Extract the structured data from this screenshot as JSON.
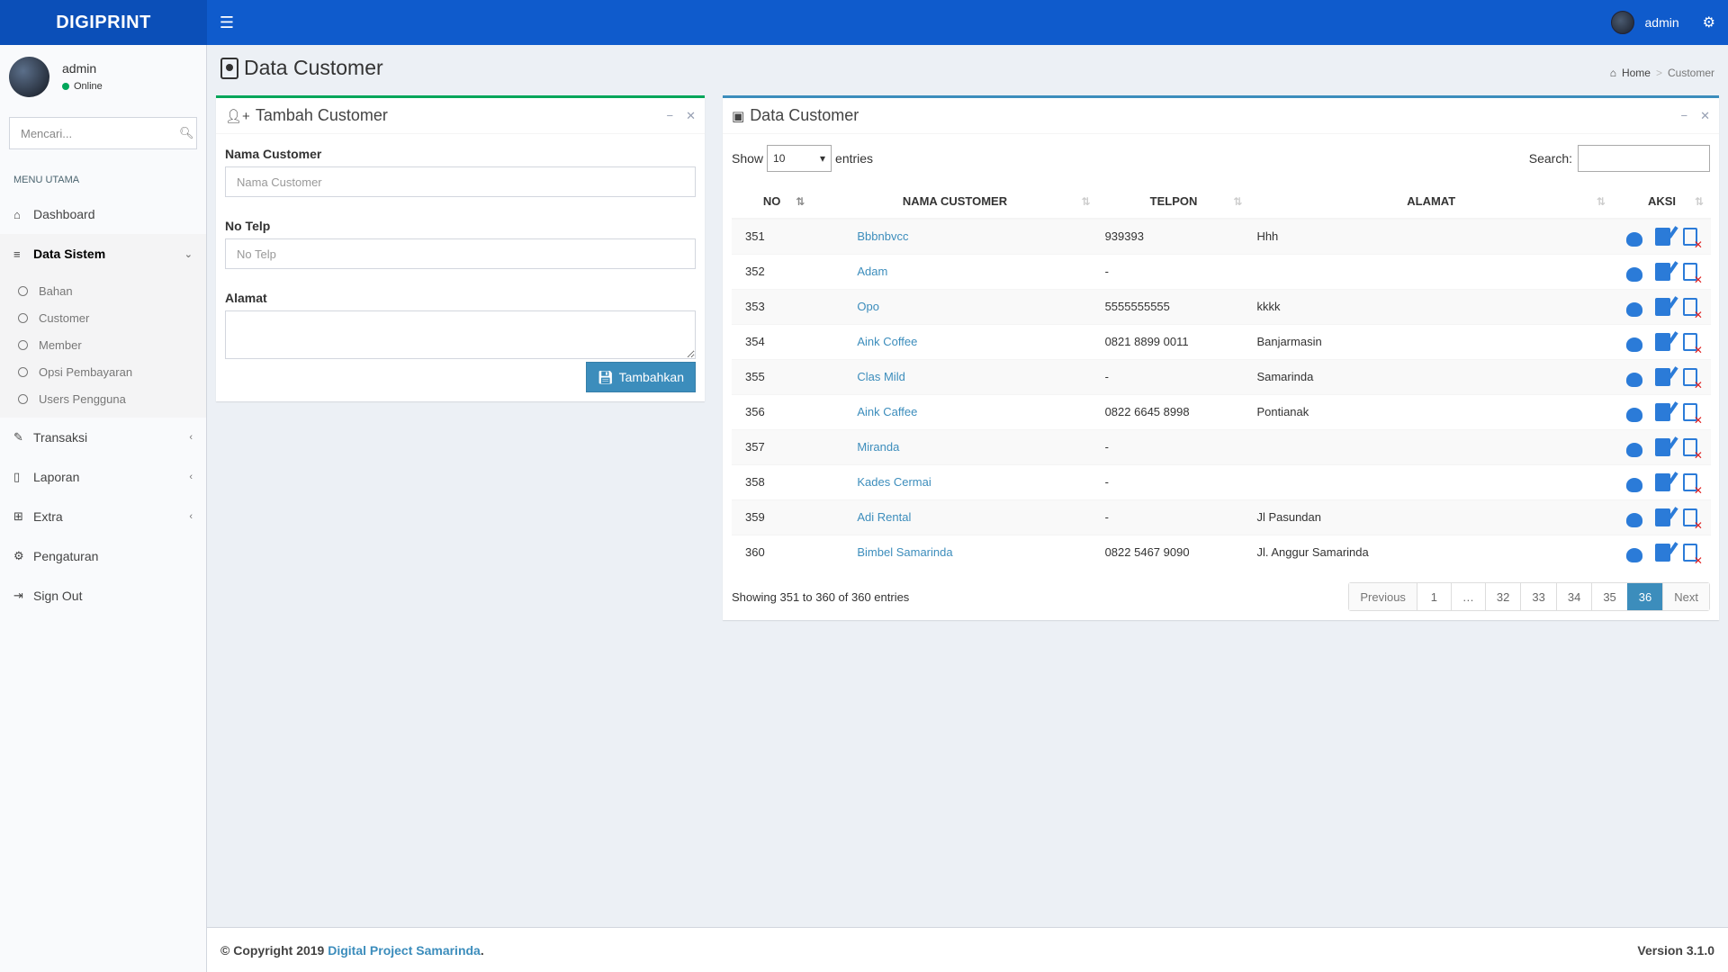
{
  "brand": "DIGIPRINT",
  "header": {
    "user_name": "admin"
  },
  "sidebar": {
    "user_name": "admin",
    "status": "Online",
    "search_placeholder": "Mencari...",
    "menu_header": "MENU UTAMA",
    "items": [
      {
        "label": "Dashboard"
      },
      {
        "label": "Data Sistem",
        "sub": [
          "Bahan",
          "Customer",
          "Member",
          "Opsi Pembayaran",
          "Users Pengguna"
        ]
      },
      {
        "label": "Transaksi"
      },
      {
        "label": "Laporan"
      },
      {
        "label": "Extra"
      },
      {
        "label": "Pengaturan"
      },
      {
        "label": "Sign Out"
      }
    ]
  },
  "page": {
    "title": "Data Customer",
    "breadcrumb": {
      "home": "Home",
      "current": "Customer"
    }
  },
  "form": {
    "title": "Tambah Customer",
    "nama_label": "Nama Customer",
    "nama_placeholder": "Nama Customer",
    "telp_label": "No Telp",
    "telp_placeholder": "No Telp",
    "alamat_label": "Alamat",
    "submit_label": "Tambahkan"
  },
  "table_box": {
    "title": "Data Customer",
    "show_label": "Show",
    "entries_value": "10",
    "entries_label": "entries",
    "search_label": "Search:",
    "columns": [
      "NO",
      "NAMA CUSTOMER",
      "TELPON",
      "ALAMAT",
      "AKSI"
    ],
    "rows": [
      [
        "351",
        "Bbbnbvcc",
        "939393",
        "Hhh"
      ],
      [
        "352",
        "Adam",
        "-",
        ""
      ],
      [
        "353",
        "Opo",
        "5555555555",
        "kkkk"
      ],
      [
        "354",
        "Aink Coffee",
        "0821 8899 0011",
        "Banjarmasin"
      ],
      [
        "355",
        "Clas Mild",
        "-",
        "Samarinda"
      ],
      [
        "356",
        "Aink Caffee",
        "0822 6645 8998",
        "Pontianak"
      ],
      [
        "357",
        "Miranda",
        "-",
        ""
      ],
      [
        "358",
        "Kades Cermai",
        "-",
        ""
      ],
      [
        "359",
        "Adi Rental",
        "-",
        "Jl Pasundan"
      ],
      [
        "360",
        "Bimbel Samarinda",
        "0822 5467 9090",
        "Jl. Anggur Samarinda"
      ]
    ],
    "info": "Showing 351 to 360 of 360 entries",
    "pagination": [
      "Previous",
      "1",
      "…",
      "32",
      "33",
      "34",
      "35",
      "36",
      "Next"
    ],
    "current_page": "36"
  },
  "footer": {
    "copyright": "© Copyright 2019",
    "company": "Digital Project Samarinda",
    "version": "Version 3.1.0"
  },
  "colors": {
    "header": "#0f5bcc",
    "primary": "#3c8dbc",
    "success": "#00a65a"
  }
}
